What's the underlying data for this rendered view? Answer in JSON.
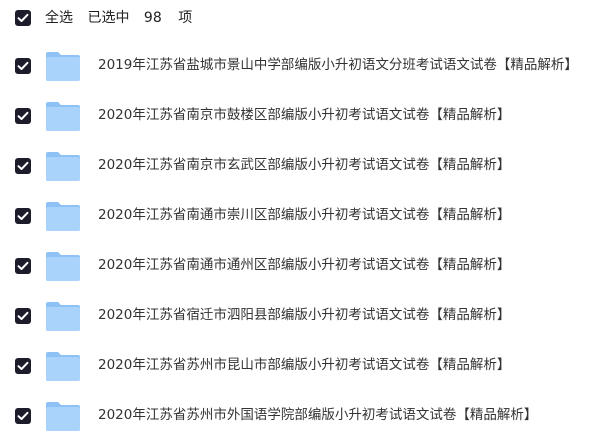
{
  "header": {
    "select_all_label": "全选",
    "selected_prefix": "已选中",
    "selected_count": "98",
    "selected_suffix": "项"
  },
  "files": [
    {
      "name": "2019年江苏省盐城市景山中学部编版小升初语文分班考试语文试卷【精品解析】",
      "icon": "folder-icon",
      "checked": true
    },
    {
      "name": "2020年江苏省南京市鼓楼区部编版小升初考试语文试卷【精品解析】",
      "icon": "folder-icon",
      "checked": true
    },
    {
      "name": "2020年江苏省南京市玄武区部编版小升初考试语文试卷【精品解析】",
      "icon": "folder-icon",
      "checked": true
    },
    {
      "name": "2020年江苏省南通市崇川区部编版小升初考试语文试卷【精品解析】",
      "icon": "folder-icon",
      "checked": true
    },
    {
      "name": "2020年江苏省南通市通州区部编版小升初考试语文试卷【精品解析】",
      "icon": "folder-icon",
      "checked": true
    },
    {
      "name": "2020年江苏省宿迁市泗阳县部编版小升初考试语文试卷【精品解析】",
      "icon": "folder-icon",
      "checked": true
    },
    {
      "name": "2020年江苏省苏州市昆山市部编版小升初考试语文试卷【精品解析】",
      "icon": "folder-icon",
      "checked": true
    },
    {
      "name": "2020年江苏省苏州市外国语学院部编版小升初考试语文试卷【精品解析】",
      "icon": "folder-icon",
      "checked": true
    }
  ],
  "colors": {
    "checkbox_fill": "#1c1c2a",
    "folder_back": "#8ec2f4",
    "folder_front": "#a9d3fb"
  }
}
